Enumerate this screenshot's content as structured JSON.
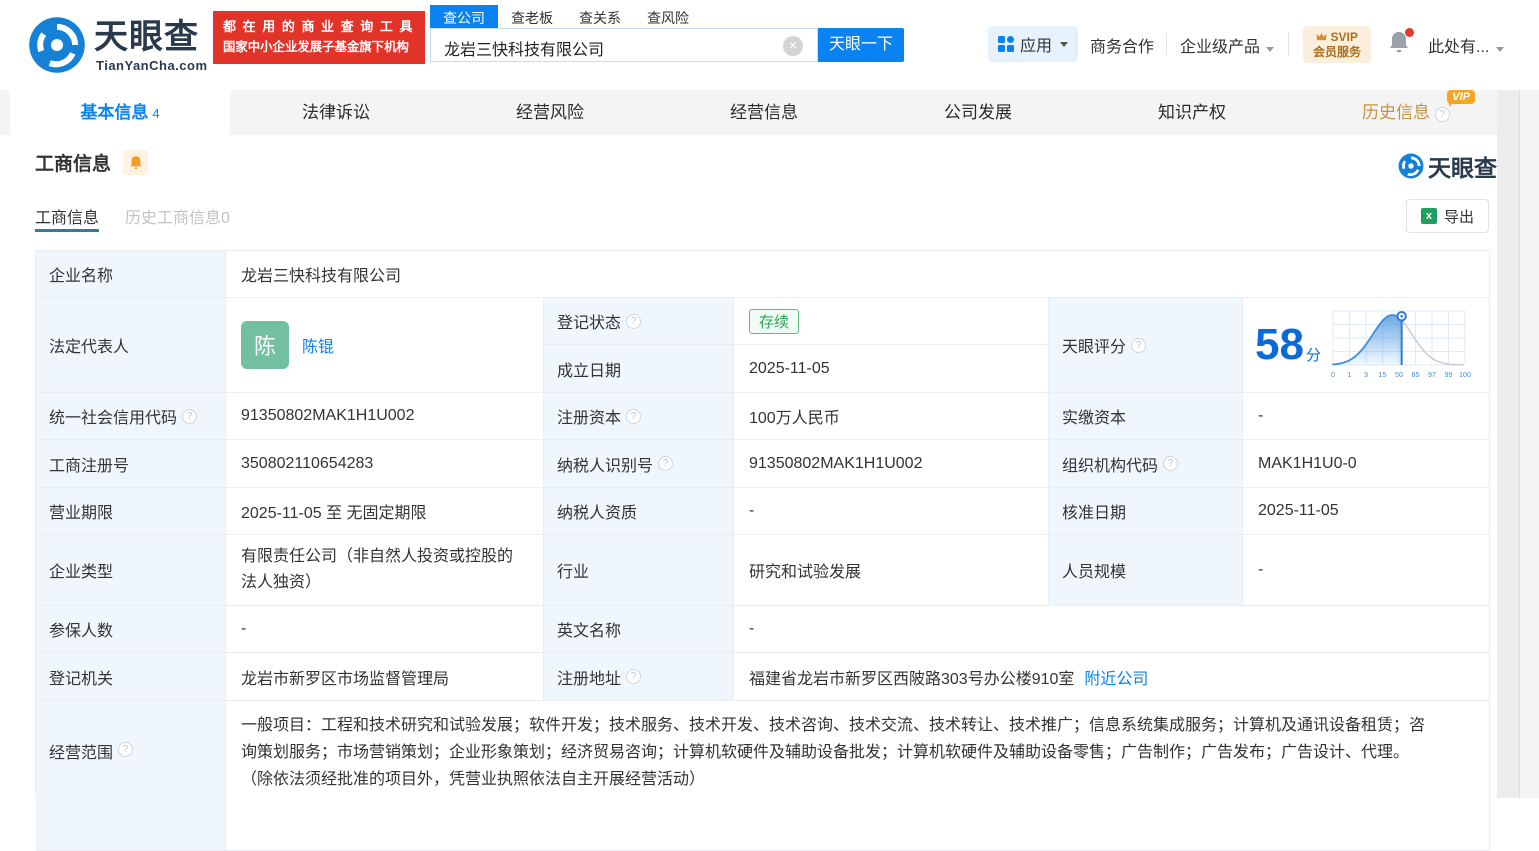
{
  "header": {
    "logo": {
      "brand": "天眼查",
      "domain": "TianYanCha.com"
    },
    "banner": {
      "line1": "都 在 用 的 商 业 查 询 工 具",
      "line2": "国家中小企业发展子基金旗下机构"
    },
    "search": {
      "tabs": [
        "查公司",
        "查老板",
        "查关系",
        "查风险"
      ],
      "active_tab": "查公司",
      "value": "龙岩三快科技有限公司",
      "button": "天眼一下"
    },
    "menu": {
      "apps": "应用",
      "cooperation": "商务合作",
      "enterprise": "企业级产品",
      "svip_line1": "SVIP",
      "svip_line2": "会员服务",
      "account": "此处有..."
    }
  },
  "nav": {
    "tabs": [
      {
        "label": "基本信息",
        "count": "4"
      },
      {
        "label": "法律诉讼"
      },
      {
        "label": "经营风险"
      },
      {
        "label": "经营信息"
      },
      {
        "label": "公司发展"
      },
      {
        "label": "知识产权"
      },
      {
        "label": "历史信息",
        "vip": "VIP"
      }
    ]
  },
  "section": {
    "title": "工商信息",
    "watermark": "天眼查",
    "subtab_active": "工商信息",
    "subtab_history": "历史工商信息0",
    "export_label": "导出"
  },
  "table": {
    "company_name": {
      "label": "企业名称",
      "value": "龙岩三快科技有限公司"
    },
    "legal_rep": {
      "label": "法定代表人",
      "avatar": "陈",
      "name": "陈锟"
    },
    "reg_status": {
      "label": "登记状态",
      "value": "存续"
    },
    "establish_date": {
      "label": "成立日期",
      "value": "2025-11-05"
    },
    "score": {
      "label": "天眼评分",
      "value": "58",
      "unit": "分"
    },
    "credit_code": {
      "label": "统一社会信用代码",
      "value": "91350802MAK1H1U002"
    },
    "reg_capital": {
      "label": "注册资本",
      "value": "100万人民币"
    },
    "paid_capital": {
      "label": "实缴资本",
      "value": "-"
    },
    "reg_number": {
      "label": "工商注册号",
      "value": "350802110654283"
    },
    "taxpayer_id": {
      "label": "纳税人识别号",
      "value": "91350802MAK1H1U002"
    },
    "org_code": {
      "label": "组织机构代码",
      "value": "MAK1H1U0-0"
    },
    "business_term": {
      "label": "营业期限",
      "value": "2025-11-05 至 无固定期限"
    },
    "taxpayer_qualification": {
      "label": "纳税人资质",
      "value": "-"
    },
    "approval_date": {
      "label": "核准日期",
      "value": "2025-11-05"
    },
    "company_type": {
      "label": "企业类型",
      "value": "有限责任公司（非自然人投资或控股的法人独资）"
    },
    "industry": {
      "label": "行业",
      "value": "研究和试验发展"
    },
    "staff_size": {
      "label": "人员规模",
      "value": "-"
    },
    "insured_count": {
      "label": "参保人数",
      "value": "-"
    },
    "english_name": {
      "label": "英文名称",
      "value": "-"
    },
    "reg_authority": {
      "label": "登记机关",
      "value": "龙岩市新罗区市场监督管理局"
    },
    "reg_address": {
      "label": "注册地址",
      "value": "福建省龙岩市新罗区西陂路303号办公楼910室",
      "link": "附近公司"
    },
    "business_scope": {
      "label": "经营范围",
      "value": "一般项目：工程和技术研究和试验发展；软件开发；技术服务、技术开发、技术咨询、技术交流、技术转让、技术推广；信息系统集成服务；计算机及通讯设备租赁；咨询策划服务；市场营销策划；企业形象策划；经济贸易咨询；计算机软硬件及辅助设备批发；计算机软硬件及辅助设备零售；广告制作；广告发布；广告设计、代理。\n（除依法须经批准的项目外，凭营业执照依法自主开展经营活动）"
    }
  },
  "chart_data": {
    "type": "area",
    "title": "天眼评分",
    "score": 58,
    "x_ticks": [
      "0",
      "1",
      "3",
      "15",
      "50",
      "85",
      "97",
      "99",
      "100"
    ],
    "curve": "normal-distribution",
    "peak_percent": 45,
    "marker_percent": 52,
    "sigma_percent": 15,
    "accent": "#3d8edb"
  }
}
